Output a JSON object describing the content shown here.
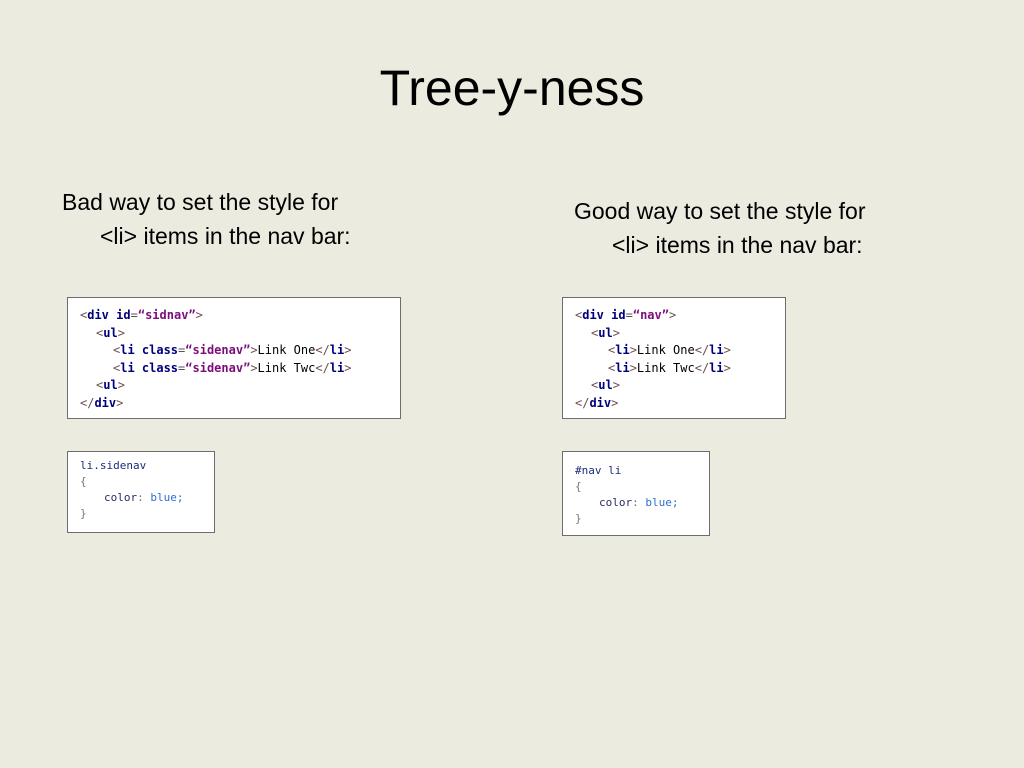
{
  "slide": {
    "title": "Tree-y-ness"
  },
  "bad": {
    "text_line1": "Bad way to set the style for",
    "text_line2": "<li> items in the nav bar:",
    "html_code": {
      "div_open": {
        "lt": "<",
        "tag": "div",
        "attr": " id",
        "eq": "=",
        "val": "“sidnav”",
        "gt": ">"
      },
      "ul_open": {
        "lt": "<",
        "tag": "ul",
        "gt": ">"
      },
      "li1": {
        "lt": "<",
        "tag": "li",
        "attr": " class",
        "eq": "=",
        "val": "“sidenav”",
        "gt": ">",
        "text": "Link One",
        "close_lt": "</",
        "close_tag": "li",
        "close_gt": ">"
      },
      "li2": {
        "lt": "<",
        "tag": "li",
        "attr": " class",
        "eq": "=",
        "val": "“sidenav”",
        "gt": ">",
        "text": "Link Twc",
        "close_lt": "</",
        "close_tag": "li",
        "close_gt": ">"
      },
      "ul_close": {
        "lt": "<",
        "tag": "ul",
        "gt": ">"
      },
      "div_close": {
        "lt": "</",
        "tag": "div",
        "gt": ">"
      }
    },
    "css_code": {
      "selector": "li.sidenav",
      "open_brace": "{",
      "property": "color",
      "colon": ": ",
      "value": "blue;",
      "close_brace": "}"
    }
  },
  "good": {
    "text_line1": "Good way to set the style for",
    "text_line2": "<li> items in the nav bar:",
    "html_code": {
      "div_open": {
        "lt": "<",
        "tag": "div",
        "attr": " id",
        "eq": "=",
        "val": "“nav”",
        "gt": ">"
      },
      "ul_open": {
        "lt": "<",
        "tag": "ul",
        "gt": ">"
      },
      "li1": {
        "lt": "<",
        "tag": "li",
        "gt": ">",
        "text": "Link One",
        "close_lt": "</",
        "close_tag": "li",
        "close_gt": ">"
      },
      "li2": {
        "lt": "<",
        "tag": "li",
        "gt": ">",
        "text": "Link Twc",
        "close_lt": "</",
        "close_tag": "li",
        "close_gt": ">"
      },
      "ul_close": {
        "lt": "<",
        "tag": "ul",
        "gt": ">"
      },
      "div_close": {
        "lt": "</",
        "tag": "div",
        "gt": ">"
      }
    },
    "css_code": {
      "selector": "#nav li",
      "open_brace": "{",
      "property": "color",
      "colon": ": ",
      "value": "blue;",
      "close_brace": "}"
    }
  }
}
